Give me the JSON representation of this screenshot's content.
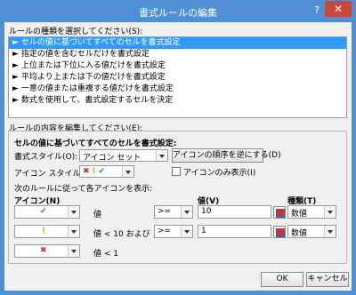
{
  "title": "書式ルールの編集",
  "help_label": "?",
  "close_label": "✕",
  "rule_type_label": "ルールの種類を選択してください(S):",
  "rule_types": [
    "セルの値に基づいてすべてのセルを書式設定",
    "指定の値を含むセルだけを書式設定",
    "上位または下位に入る値だけを書式設定",
    "平均より上または下の値だけを書式設定",
    "一意の値または重複する値だけを書式設定",
    "数式を使用して、書式設定するセルを決定"
  ],
  "edit_label": "ルールの内容を編集してください(E):",
  "group": {
    "heading": "セルの値に基づいてすべてのセルを書式設定:",
    "format_style_label": "書式スタイル(O):",
    "format_style_value": "アイコン セット",
    "reverse_button": "アイコンの順序を逆にする(D)",
    "icon_style_label": "アイコン スタイル(C):",
    "show_icon_only_label": "アイコンのみ表示(I)",
    "display_rule_label": "次のルールに従って各アイコンを表示:",
    "col_icon": "アイコン(N)",
    "col_value": "値(V)",
    "col_type": "種類(T)",
    "rows": [
      {
        "icon": "check-icon",
        "glyph": "✔",
        "condition": "値",
        "operator": ">=",
        "value": "10",
        "type": "数値"
      },
      {
        "icon": "exclamation-icon",
        "glyph": "!",
        "condition": "値 < 10 および",
        "operator": ">=",
        "value": "1",
        "type": "数値"
      },
      {
        "icon": "x-icon",
        "glyph": "✖",
        "condition": "値 < 1"
      }
    ]
  },
  "ok_button": "OK",
  "cancel_button": "キャンセル",
  "colors": {
    "titlebar": "#4f8fd6",
    "close": "#c9463d",
    "selection": "#3399ff"
  }
}
